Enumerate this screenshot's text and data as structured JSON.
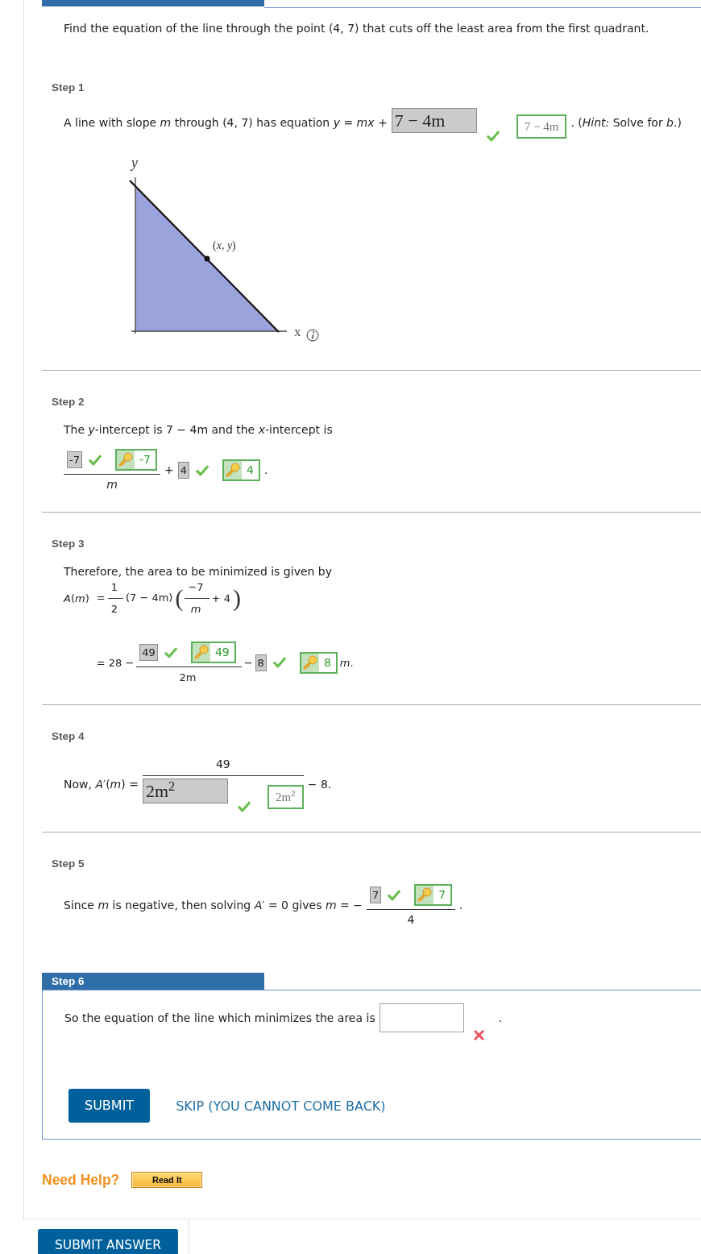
{
  "question": "Find the equation of the line through the point (4, 7) that cuts off the least area from the first quadrant.",
  "steps": [
    {
      "label": "Step 1",
      "current": false,
      "lines": [
        [
          {
            "kind": "text",
            "text": "A line with slope *m* through (4, 7) has equation *y* = *mx* +"
          },
          {
            "kind": "math_entry",
            "value": "7 − 4m",
            "correct": true,
            "solution": "7 − 4m"
          },
          {
            "kind": "text",
            "text": ". (*Hint:* Solve for *b*.)"
          }
        ],
        [
          {
            "kind": "graph",
            "y_label": "y",
            "x_label": "x",
            "point_label": "(*x*, *y*)"
          }
        ]
      ]
    },
    {
      "label": "Step 2",
      "current": false,
      "lines": [
        [
          {
            "kind": "text",
            "text": "The *y*-intercept is 7 − 4m and the *x*-intercept is"
          }
        ],
        [
          {
            "kind": "fraction",
            "numerator": [
              {
                "kind": "number_entry",
                "value": "-7",
                "correct": true,
                "solution": "-7"
              }
            ],
            "denominator": [
              {
                "kind": "text",
                "text": "*m*"
              }
            ]
          },
          {
            "kind": "text",
            "text": "+"
          },
          {
            "kind": "number_entry",
            "value": "4",
            "correct": true,
            "solution": "4"
          },
          {
            "kind": "text",
            "text": "."
          }
        ]
      ]
    },
    {
      "label": "Step 3",
      "current": false,
      "lines": [
        [
          {
            "kind": "text",
            "text": "Therefore, the area to be minimized is given by"
          }
        ],
        [
          {
            "kind": "equation",
            "rows": [
              {
                "lhs": [
                  {
                    "kind": "text",
                    "text": "*A*(*m*)"
                  }
                ],
                "rhs": [
                  {
                    "kind": "text",
                    "text": "="
                  },
                  {
                    "kind": "fraction",
                    "numerator": [
                      {
                        "kind": "text",
                        "text": "1"
                      }
                    ],
                    "denominator": [
                      {
                        "kind": "text",
                        "text": "2"
                      }
                    ]
                  },
                  {
                    "kind": "text",
                    "text": "(7 − 4m)"
                  },
                  {
                    "kind": "paren_group",
                    "open": "(",
                    "close": ")",
                    "items": [
                      {
                        "kind": "fraction",
                        "numerator": [
                          {
                            "kind": "text",
                            "text": "−7"
                          }
                        ],
                        "denominator": [
                          {
                            "kind": "text",
                            "text": "*m*"
                          }
                        ]
                      },
                      {
                        "kind": "text",
                        "text": "+ 4"
                      }
                    ]
                  }
                ]
              },
              {
                "rhs": [
                  {
                    "kind": "text",
                    "text": "= 28 −"
                  },
                  {
                    "kind": "fraction",
                    "numerator": [
                      {
                        "kind": "number_entry",
                        "value": "49",
                        "correct": true,
                        "solution": "49"
                      }
                    ],
                    "denominator": [
                      {
                        "kind": "text",
                        "text": "2m"
                      }
                    ]
                  },
                  {
                    "kind": "text",
                    "text": "−"
                  },
                  {
                    "kind": "number_entry",
                    "value": "8",
                    "correct": true,
                    "solution": "8"
                  },
                  {
                    "kind": "text",
                    "text": "*m*."
                  }
                ]
              }
            ]
          }
        ]
      ]
    },
    {
      "label": "Step 4",
      "current": false,
      "lines": [
        [
          {
            "kind": "text",
            "text": "Now, *A*′(*m*) ="
          },
          {
            "kind": "fraction",
            "numerator": [
              {
                "kind": "text",
                "text": "49"
              }
            ],
            "denominator": [
              {
                "kind": "math_entry",
                "value": "2m$^{2}$",
                "correct": true,
                "solution": "2m$^{2}$"
              }
            ]
          },
          {
            "kind": "text",
            "text": "− 8."
          }
        ]
      ]
    },
    {
      "label": "Step 5",
      "current": false,
      "lines": [
        [
          {
            "kind": "text",
            "text": "Since *m* is negative, then solving *A*′ = 0 gives *m* = −"
          },
          {
            "kind": "fraction",
            "numerator": [
              {
                "kind": "number_entry",
                "value": "7",
                "correct": true,
                "solution": "7"
              }
            ],
            "denominator": [
              {
                "kind": "text",
                "text": "4"
              }
            ]
          },
          {
            "kind": "text",
            "text": "."
          }
        ]
      ]
    },
    {
      "label": "Step 6",
      "current": true,
      "lines": [
        [
          {
            "kind": "text",
            "text": "So the equation of the line which minimizes the area is"
          },
          {
            "kind": "text_entry",
            "correct": false
          },
          {
            "kind": "text",
            "text": "."
          }
        ]
      ],
      "buttons": [
        {
          "kind": "primary",
          "label": "SUBMIT"
        },
        {
          "kind": "link",
          "label": "SKIP (YOU CANNOT COME BACK)"
        }
      ]
    }
  ],
  "help": {
    "title": "Need Help?",
    "buttons": [
      "Read It"
    ]
  },
  "submit_button": "SUBMIT ANSWER"
}
